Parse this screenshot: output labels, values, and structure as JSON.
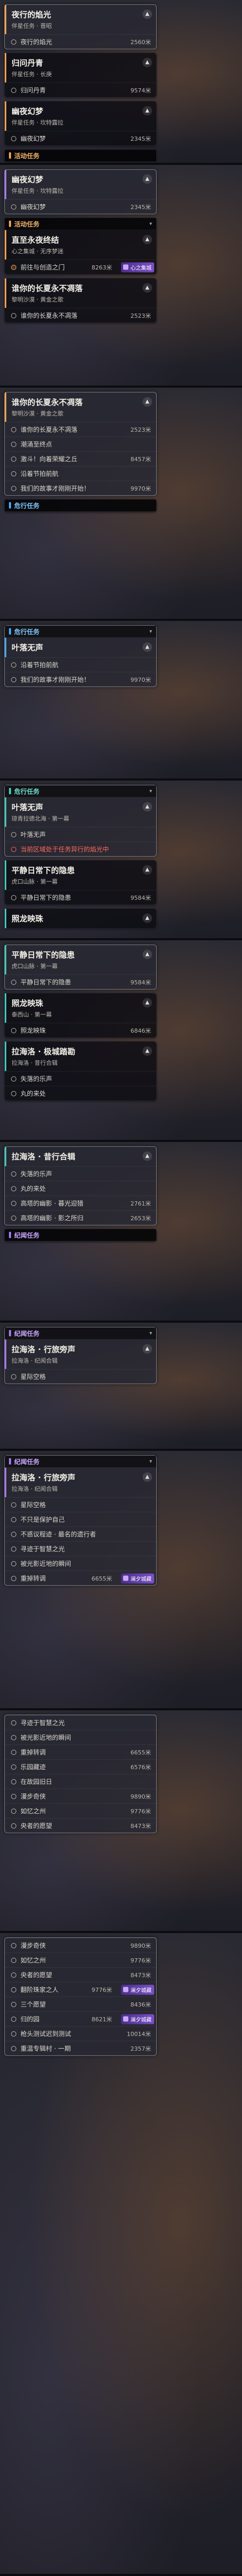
{
  "colors": {
    "accent_orange": "#f0a050",
    "accent_blue": "#4aa8f0",
    "accent_purple": "#a878f0",
    "accent_teal": "#3fc8b8",
    "warning_red": "#ff6a5a",
    "badge_purple": "#7b4fc8"
  },
  "panels": [
    {
      "sections": [
        {
          "quest": {
            "title": "夜行的焰光",
            "subtitle": "伴星任务 · 晋昭",
            "accent": "orange"
          },
          "items": [
            {
              "label": "夜行的焰光",
              "dist": "2560米",
              "icon": "ring"
            }
          ]
        },
        {
          "quest": {
            "title": "归问丹青",
            "subtitle": "伴星任务 · 长庚",
            "accent": "orange"
          },
          "items": [
            {
              "label": "归问丹青",
              "dist": "9574米",
              "icon": "ring"
            }
          ]
        },
        {
          "quest": {
            "title": "幽夜幻梦",
            "subtitle": "伴星任务 · 坎特露拉",
            "accent": "orange"
          },
          "items": [
            {
              "label": "幽夜幻梦",
              "dist": "2345米",
              "icon": "ring"
            }
          ]
        }
      ],
      "footer_category": {
        "label": "活动任务",
        "color": "orange"
      }
    },
    {
      "sections": [
        {
          "quest": {
            "title": "幽夜幻梦",
            "subtitle": "伴星任务 · 坎特露拉",
            "accent": "purple"
          },
          "items": [
            {
              "label": "幽夜幻梦",
              "dist": "2345米",
              "icon": "ring"
            }
          ]
        },
        {
          "category": {
            "label": "活动任务",
            "color": "orange"
          },
          "quest": {
            "title": "直至永夜终结",
            "subtitle": "心之集城 · 无序梦迷",
            "accent": "orange"
          },
          "items": [
            {
              "label": "前往与创造之门",
              "dist": "8263米",
              "icon": "pin",
              "badge": "心之集城"
            }
          ]
        },
        {
          "quest": {
            "title": "谁你的长夏永不凋落",
            "subtitle": "黎明沙漠 · 黄金之歌",
            "accent": "orange"
          },
          "items": [
            {
              "label": "谁你的长夏永不凋落",
              "dist": "2523米",
              "icon": "ring"
            }
          ]
        }
      ]
    },
    {
      "sections": [
        {
          "quest": {
            "title": "谁你的长夏永不凋落",
            "subtitle": "黎明沙漠 · 黄金之歌",
            "accent": "orange"
          },
          "items": [
            {
              "label": "谁你的长夏永不凋落",
              "dist": "2523米",
              "icon": "ring"
            },
            {
              "label": "潮涌至终点",
              "dist": "",
              "icon": "ring"
            },
            {
              "label": "激斗！向着荣耀之丘",
              "dist": "8457米",
              "icon": "ring"
            },
            {
              "label": "沿着节拍前航",
              "dist": "",
              "icon": "ring"
            },
            {
              "label": "我们的故事才刚刚开始！",
              "dist": "9970米",
              "icon": "ring"
            }
          ]
        }
      ],
      "footer_category": {
        "label": "危行任务",
        "color": "blue"
      }
    },
    {
      "sections": [
        {
          "category": {
            "label": "危行任务",
            "color": "blue"
          },
          "quest": {
            "title": "叶落无声",
            "subtitle": "",
            "accent": "blue"
          },
          "items": [
            {
              "label": "沿着节拍前航",
              "dist": "",
              "icon": "ring"
            },
            {
              "label": "我们的故事才刚刚开始！",
              "dist": "9970米",
              "icon": "ring"
            }
          ]
        }
      ]
    },
    {
      "sections": [
        {
          "category": {
            "label": "危行任务",
            "color": "teal"
          },
          "quest": {
            "title": "叶落无声",
            "subtitle": "琼青拉德北海 · 第一幕",
            "accent": "teal"
          },
          "items": [
            {
              "label": "叶落无声",
              "dist": "",
              "icon": "ring"
            },
            {
              "label": "当前区域处于任务异行的焰光中",
              "dist": "",
              "icon": "ring",
              "red": true
            }
          ]
        },
        {
          "quest": {
            "title": "平静日常下的隐患",
            "subtitle": "虎口山脉 · 第一幕",
            "accent": "teal"
          },
          "items": [
            {
              "label": "平静日常下的隐患",
              "dist": "9584米",
              "icon": "ring"
            }
          ]
        },
        {
          "quest": {
            "title": "照龙映珠",
            "subtitle": "",
            "accent": "teal"
          },
          "items": []
        }
      ]
    },
    {
      "sections": [
        {
          "quest": {
            "title": "平静日常下的隐患",
            "subtitle": "虎口山脉 · 第一幕",
            "accent": "teal"
          },
          "items": [
            {
              "label": "平静日常下的隐患",
              "dist": "9584米",
              "icon": "ring"
            }
          ]
        },
        {
          "quest": {
            "title": "照龙映珠",
            "subtitle": "泰西山 · 第一幕",
            "accent": "teal"
          },
          "items": [
            {
              "label": "照龙映珠",
              "dist": "6846米",
              "icon": "ring"
            }
          ]
        },
        {
          "quest": {
            "title": "拉海洛 · 极城踏勘",
            "subtitle": "拉海洛 · 昔行合辑",
            "accent": "teal"
          },
          "items": [
            {
              "label": "失落的乐声",
              "dist": "",
              "icon": "ring"
            },
            {
              "label": "丸的来处",
              "dist": "",
              "icon": "ring"
            }
          ]
        }
      ]
    },
    {
      "sections": [
        {
          "quest": {
            "title": "拉海洛 · 昔行合辑",
            "subtitle": "",
            "accent": "teal"
          },
          "items": [
            {
              "label": "失落的乐声",
              "dist": "",
              "icon": "ring"
            },
            {
              "label": "丸的来处",
              "dist": "",
              "icon": "ring"
            },
            {
              "label": "高塔的幽影 · 暮光迎猎",
              "dist": "2761米",
              "icon": "ring"
            },
            {
              "label": "高塔的幽影 · 影之所归",
              "dist": "2653米",
              "icon": "ring"
            }
          ]
        }
      ],
      "footer_category": {
        "label": "纪闻任务",
        "color": "purple"
      }
    },
    {
      "sections": [
        {
          "category": {
            "label": "纪闻任务",
            "color": "purple"
          },
          "quest": {
            "title": "拉海洛 · 行旅旁声",
            "subtitle": "拉海洛 · 纪闻合辑",
            "accent": "purple"
          },
          "items": [
            {
              "label": "星际空格",
              "dist": "",
              "icon": "ring"
            }
          ]
        }
      ]
    },
    {
      "sections": [
        {
          "category": {
            "label": "纪闻任务",
            "color": "purple"
          },
          "quest": {
            "title": "拉海洛 · 行旅旁声",
            "subtitle": "拉海洛 · 纪闻合辑",
            "accent": "purple"
          },
          "items": [
            {
              "label": "星际空格",
              "dist": "",
              "icon": "ring"
            },
            {
              "label": "不只是保护自己",
              "dist": "",
              "icon": "ring"
            },
            {
              "label": "不惑议程迹 · 最名的遗行者",
              "dist": "",
              "icon": "ring"
            },
            {
              "label": "寻迹于智慧之光",
              "dist": "",
              "icon": "ring"
            },
            {
              "label": "被光影近地的瞬间",
              "dist": "",
              "icon": "ring"
            },
            {
              "label": "重掉转调",
              "dist": "6655米",
              "icon": "ring",
              "badge": "澜夕城藏"
            }
          ]
        }
      ]
    },
    {
      "sections": [
        {
          "quest": {
            "title": "",
            "subtitle": "",
            "accent": "purple"
          },
          "items": [
            {
              "label": "寻迹于智慧之光",
              "dist": "",
              "icon": "ring"
            },
            {
              "label": "被光影近地的瞬间",
              "dist": "",
              "icon": "ring"
            },
            {
              "label": "重掉转调",
              "dist": "6655米",
              "icon": "ring"
            },
            {
              "label": "乐园藏迹",
              "dist": "6576米",
              "icon": "ring"
            },
            {
              "label": "在故园旧日",
              "dist": "",
              "icon": "ring"
            },
            {
              "label": "漫步奇侠",
              "dist": "9890米",
              "icon": "ring"
            },
            {
              "label": "如忆之州",
              "dist": "9776米",
              "icon": "ring"
            },
            {
              "label": "央者的愿望",
              "dist": "8473米",
              "icon": "ring"
            }
          ]
        }
      ]
    },
    {
      "sections": [
        {
          "quest": {
            "title": "",
            "subtitle": "",
            "accent": "purple"
          },
          "items": [
            {
              "label": "漫步奇侠",
              "dist": "9890米",
              "icon": "ring"
            },
            {
              "label": "如忆之州",
              "dist": "9776米",
              "icon": "ring"
            },
            {
              "label": "央者的愿望",
              "dist": "8473米",
              "icon": "ring"
            },
            {
              "label": "翻阶珠家之人",
              "dist": "9776米",
              "icon": "ring",
              "badge": "澜夕城藏"
            },
            {
              "label": "三个愿望",
              "dist": "8436米",
              "icon": "ring"
            },
            {
              "label": "归的园",
              "dist": "8621米",
              "icon": "ring",
              "badge": "澜夕城藏"
            },
            {
              "label": "枪头测试迟到测试",
              "dist": "10014米",
              "icon": "ring"
            },
            {
              "label": "重温专辑村 · 一期",
              "dist": "2357米",
              "icon": "ring"
            }
          ]
        }
      ]
    }
  ]
}
